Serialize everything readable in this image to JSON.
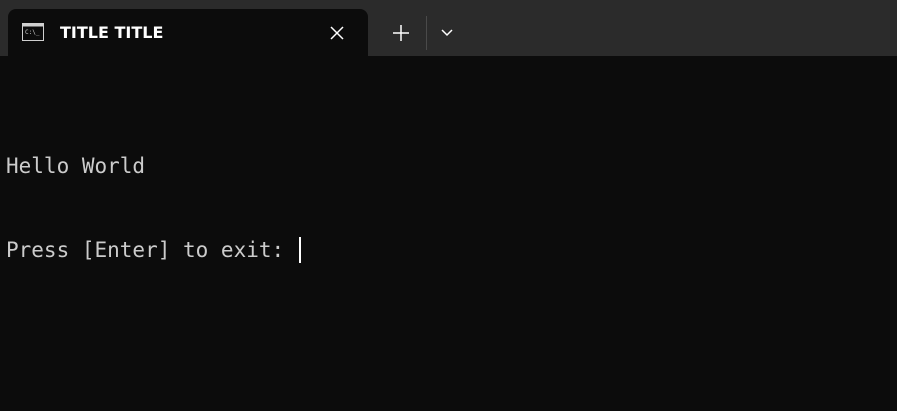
{
  "tab": {
    "title": "TITLE TITLE",
    "icon": "terminal-icon"
  },
  "toolbar": {
    "new_tab_icon": "plus-icon",
    "dropdown_icon": "chevron-down-icon"
  },
  "terminal": {
    "lines": [
      "Hello World",
      "Press [Enter] to exit: "
    ]
  },
  "colors": {
    "background": "#0c0c0c",
    "tabbar": "#2b2b2b",
    "text": "#cccccc"
  }
}
